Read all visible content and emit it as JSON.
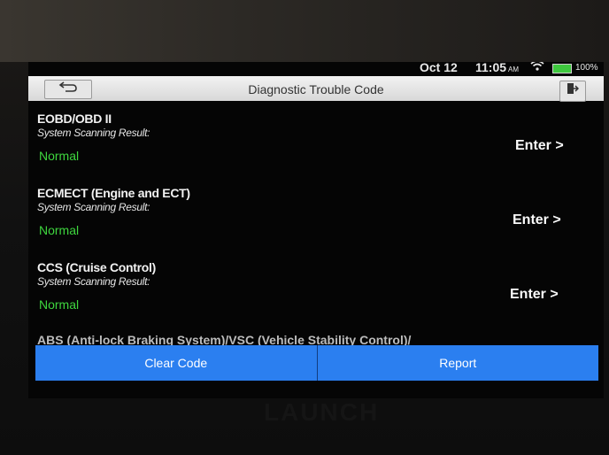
{
  "status_bar": {
    "date": "Oct 12",
    "time": "11:05",
    "ampm": "AM",
    "battery": "100%"
  },
  "title_bar": {
    "title": "Diagnostic Trouble Code",
    "back_icon": "back-arrow-icon",
    "exit_icon": "exit-icon"
  },
  "systems": [
    {
      "name": "EOBD/OBD II",
      "label": "System Scanning Result:",
      "status": "Normal",
      "action": "Enter >"
    },
    {
      "name": "ECMECT (Engine and ECT)",
      "label": "System Scanning Result:",
      "status": "Normal",
      "action": "Enter >"
    },
    {
      "name": "CCS (Cruise Control)",
      "label": "System Scanning Result:",
      "status": "Normal",
      "action": "Enter >"
    }
  ],
  "partial_item": "ABS (Anti-lock Braking System)/VSC (Vehicle Stability Control)/",
  "bottom": {
    "clear_code": "Clear Code",
    "report": "Report"
  },
  "device_logo": "LAUNCH",
  "colors": {
    "accent": "#2b7ff0",
    "status_normal": "#3ed63e"
  }
}
